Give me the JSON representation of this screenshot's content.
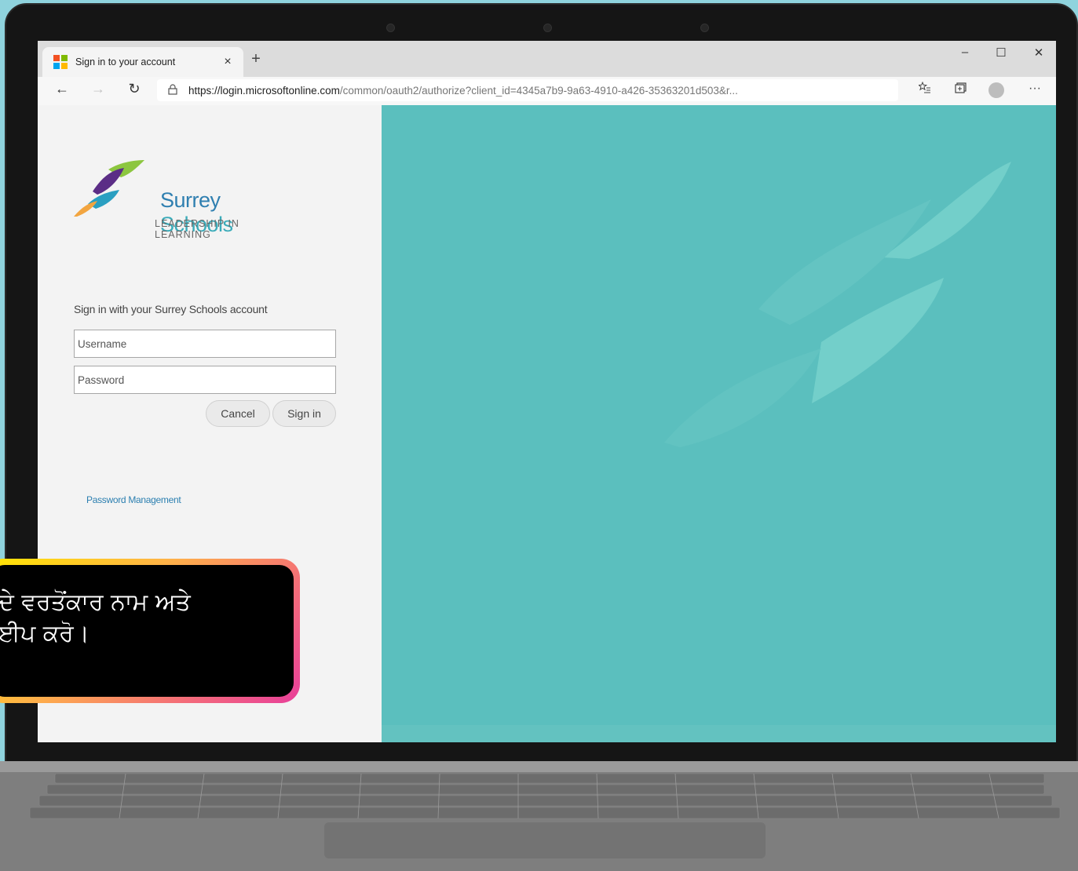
{
  "browser": {
    "tab_title": "Sign in to your account",
    "tab_close": "×",
    "new_tab": "+",
    "window_controls": {
      "minimize": "–",
      "maximize": "☐",
      "close": "✕"
    },
    "nav": {
      "back": "←",
      "forward": "→",
      "refresh": "↻"
    },
    "url_host": "https://login.microsoftonline.com",
    "url_path": "/common/oauth2/authorize?client_id=4345a7b9-9a63-4910-a426-35363201d503&r...",
    "toolbar_icons": [
      "favorites-icon",
      "collections-icon",
      "profile-icon",
      "more-icon"
    ],
    "more_label": "···"
  },
  "signin": {
    "school_name_part1": "Surrey",
    "school_name_part2": " Schools",
    "tagline": "LEADERSHIP IN LEARNING",
    "instruction": "Sign in with your Surrey Schools account",
    "username_placeholder": "Username",
    "password_placeholder": "Password",
    "cancel_label": "Cancel",
    "signin_label": "Sign in",
    "password_management": "Password Management"
  },
  "callout": {
    "line1": "ਦੇ ਵਰਤੋਂਕਾਰ ਨਾਮ ਅਤੇ",
    "line2": "ਈਪ ਕਰੋ।"
  },
  "colors": {
    "background": "#8fd3dd",
    "right_pane": "#5bbfbe",
    "link": "#2b7fb0",
    "brand_teal": "#3aabb9"
  }
}
